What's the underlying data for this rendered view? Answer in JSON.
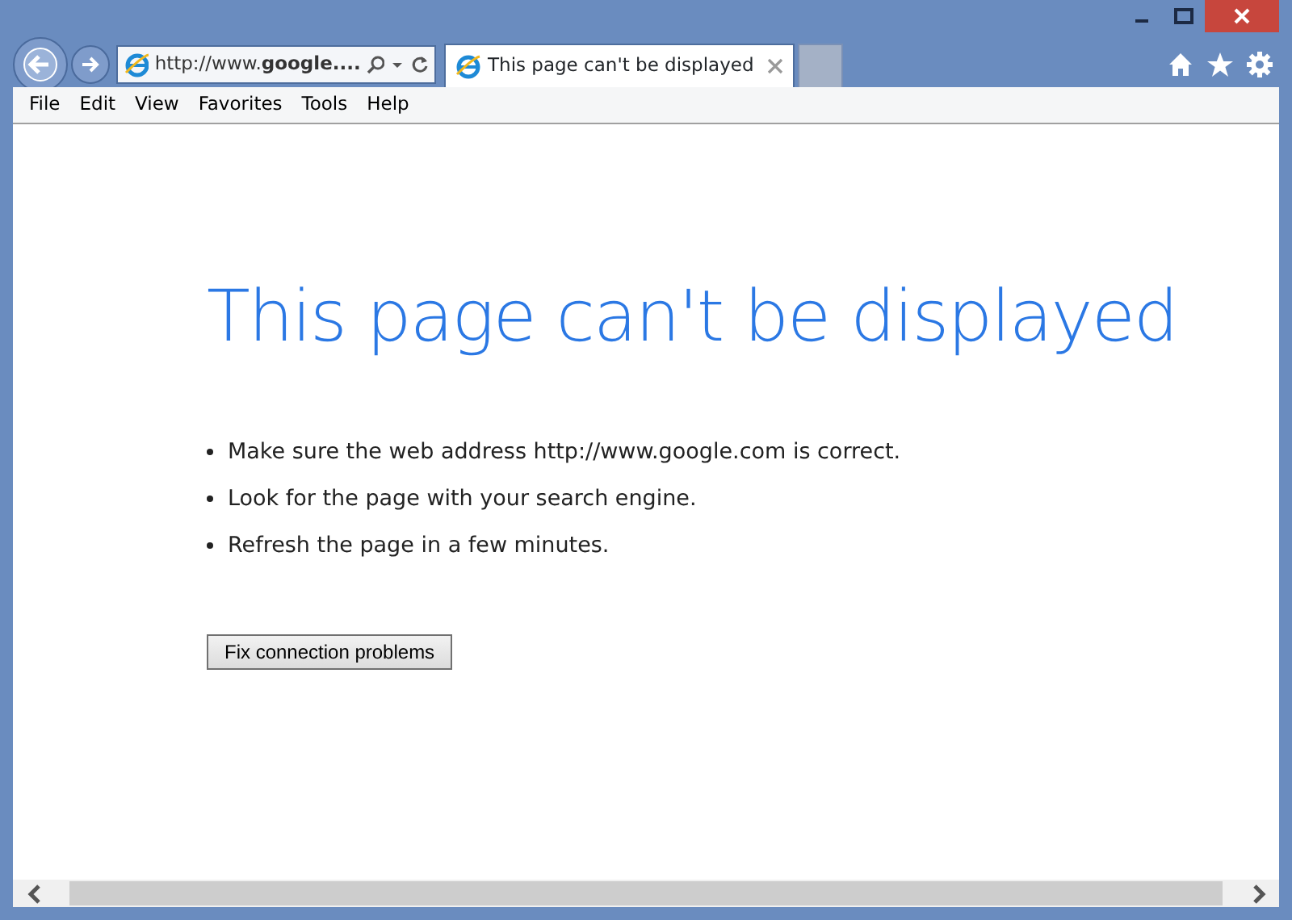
{
  "address_bar": {
    "url": "http://www.**google....**"
  },
  "tabs": [
    {
      "label": "This page can't be displayed",
      "selected": true
    }
  ],
  "menu": [
    "File",
    "Edit",
    "View",
    "Favorites",
    "Tools",
    "Help"
  ],
  "page": {
    "heading": "This page can't be displayed",
    "tips": [
      "Make sure the web address http://www.google.com is correct.",
      "Look for the page with your search engine.",
      "Refresh the page in a few minutes."
    ],
    "button": "Fix connection problems"
  }
}
